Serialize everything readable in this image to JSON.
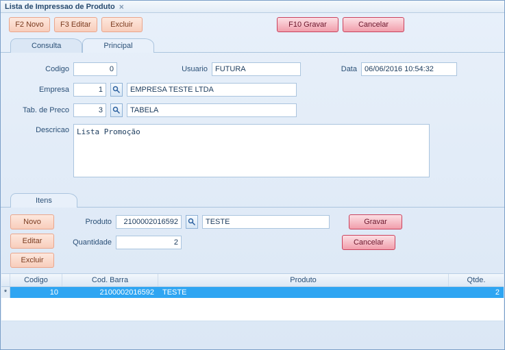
{
  "window": {
    "title": "Lista de Impressao de Produto"
  },
  "toolbar": {
    "novo": "F2 Novo",
    "editar": "F3 Editar",
    "excluir": "Excluir",
    "gravar": "F10 Gravar",
    "cancelar": "Cancelar"
  },
  "tabs": {
    "consulta": "Consulta",
    "principal": "Principal"
  },
  "labels": {
    "codigo": "Codigo",
    "usuario": "Usuario",
    "data": "Data",
    "empresa": "Empresa",
    "tabpreco": "Tab. de Preco",
    "descricao": "Descricao",
    "itens": "Itens",
    "produto": "Produto",
    "quantidade": "Quantidade"
  },
  "form": {
    "codigo": "0",
    "usuario": "FUTURA",
    "data": "06/06/2016 10:54:32",
    "empresa_cod": "1",
    "empresa_nome": "EMPRESA TESTE LTDA",
    "tabpreco_cod": "3",
    "tabpreco_nome": "TABELA",
    "descricao": "Lista Promoção"
  },
  "item_form": {
    "produto_cod": "2100002016592",
    "produto_nome": "TESTE",
    "quantidade": "2"
  },
  "item_buttons": {
    "novo": "Novo",
    "editar": "Editar",
    "excluir": "Excluir",
    "gravar": "Gravar",
    "cancelar": "Cancelar"
  },
  "grid": {
    "headers": {
      "codigo": "Codigo",
      "barra": "Cod. Barra",
      "produto": "Produto",
      "qtde": "Qtde."
    },
    "row": {
      "codigo": "10",
      "barra": "2100002016592",
      "produto": "TESTE",
      "qtde": "2"
    }
  }
}
